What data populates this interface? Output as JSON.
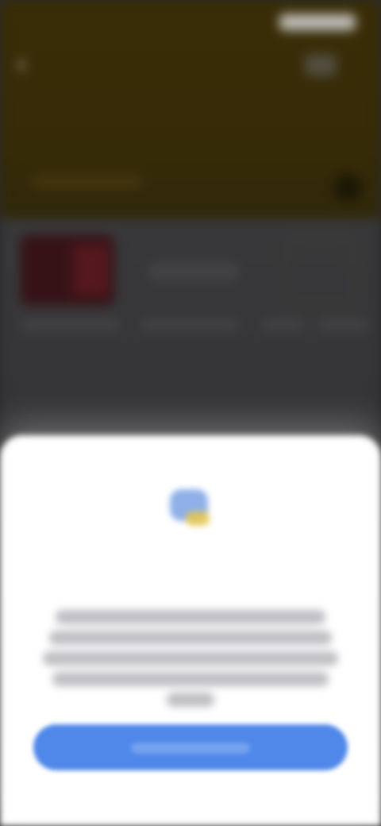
{
  "status_bar": {
    "time": "",
    "icons": [
      "signal-icon",
      "wifi-icon",
      "battery-icon"
    ]
  },
  "header": {
    "back_icon": "chevron-left-icon",
    "share_icon": "share-icon"
  },
  "content": {
    "item_title": ""
  },
  "sheet": {
    "icon": "app-badge-icon",
    "title": "",
    "body_lines": 5,
    "button_label": ""
  },
  "colors": {
    "header_background": "#3a2e08",
    "content_background": "#38383a",
    "sheet_background": "#ffffff",
    "primary_button": "#4f88e8"
  }
}
